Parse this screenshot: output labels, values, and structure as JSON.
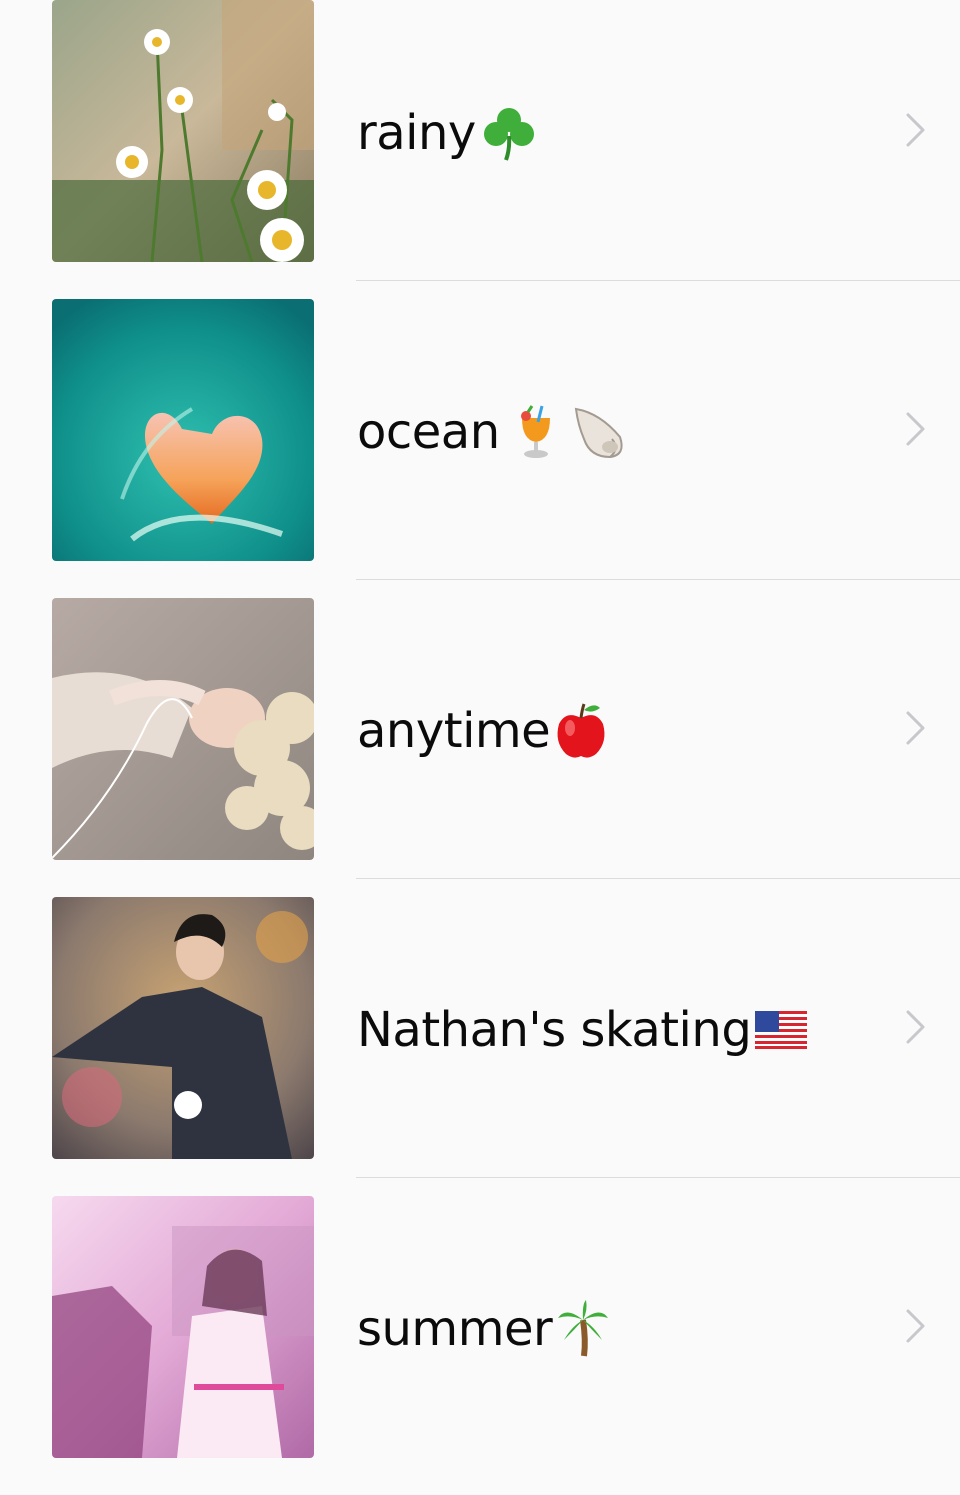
{
  "playlists": [
    {
      "title": "rainy",
      "emoji": "shamrock-icon",
      "photo": "daisies-in-rain-photo"
    },
    {
      "title": "ocean",
      "emoji": "tropical-drink-icon spiral-shell-icon",
      "photo": "heart-shaped-wave-photo"
    },
    {
      "title": "anytime",
      "emoji": "red-apple-icon",
      "photo": "woman-with-earphones-photo"
    },
    {
      "title": "Nathan's skating",
      "emoji": "us-flag-icon",
      "photo": "figure-skater-photo"
    },
    {
      "title": "summer",
      "emoji": "palm-tree-icon",
      "photo": "couple-at-outdoor-party-photo"
    }
  ],
  "colors": {
    "background": "#fafafa",
    "separator": "#dcdcdc",
    "chevron": "#c7c7cc",
    "text": "#0b0b0b"
  }
}
